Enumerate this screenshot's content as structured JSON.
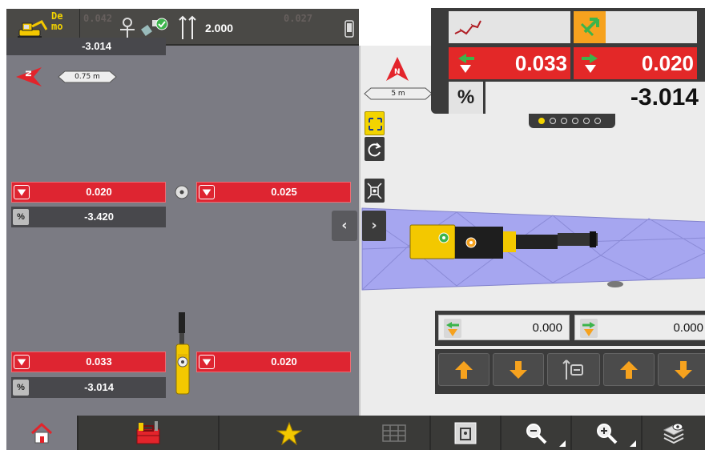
{
  "status_bar": {
    "demo_label": "De mo",
    "ghost_left": "0.042",
    "ghost_right": "0.027",
    "depth_value": "2.000"
  },
  "left_panel": {
    "top_partial_grade": "-3.014",
    "scale_label": "0.75 m",
    "middle": {
      "left_value": "0.020",
      "right_value": "0.025",
      "grade_label": "%",
      "grade_value": "-3.420"
    },
    "bottom": {
      "left_value": "0.033",
      "right_value": "0.020",
      "grade_label": "%",
      "grade_value": "-3.014"
    }
  },
  "map": {
    "north_label": "N",
    "scale_label": "5 m",
    "collapse_glyph": "‹",
    "expand_glyph": "›"
  },
  "overlay": {
    "left_value": "0.033",
    "right_value": "0.020",
    "grade_label": "%",
    "grade_value": "-3.014",
    "page_dots": 6,
    "active_dot": 0
  },
  "offsets": {
    "left_value": "0.000",
    "right_value": "0.000"
  },
  "colors": {
    "red": "#de2531",
    "yellow": "#f3c800",
    "orange": "#f6a21e",
    "green": "#3cb44b",
    "lavender": "#a6a6f0"
  },
  "icons": {
    "status": [
      "excavator-icon",
      "gps-antenna-icon",
      "satellite-icon",
      "depth-icon",
      "phone-icon"
    ],
    "bottom_left": [
      "home-icon",
      "toolbox-icon",
      "favorite-star-icon"
    ],
    "bottom_right": [
      "grid-table-icon",
      "target-tool-icon",
      "zoom-out-icon",
      "zoom-in-icon",
      "layers-eye-icon"
    ]
  }
}
